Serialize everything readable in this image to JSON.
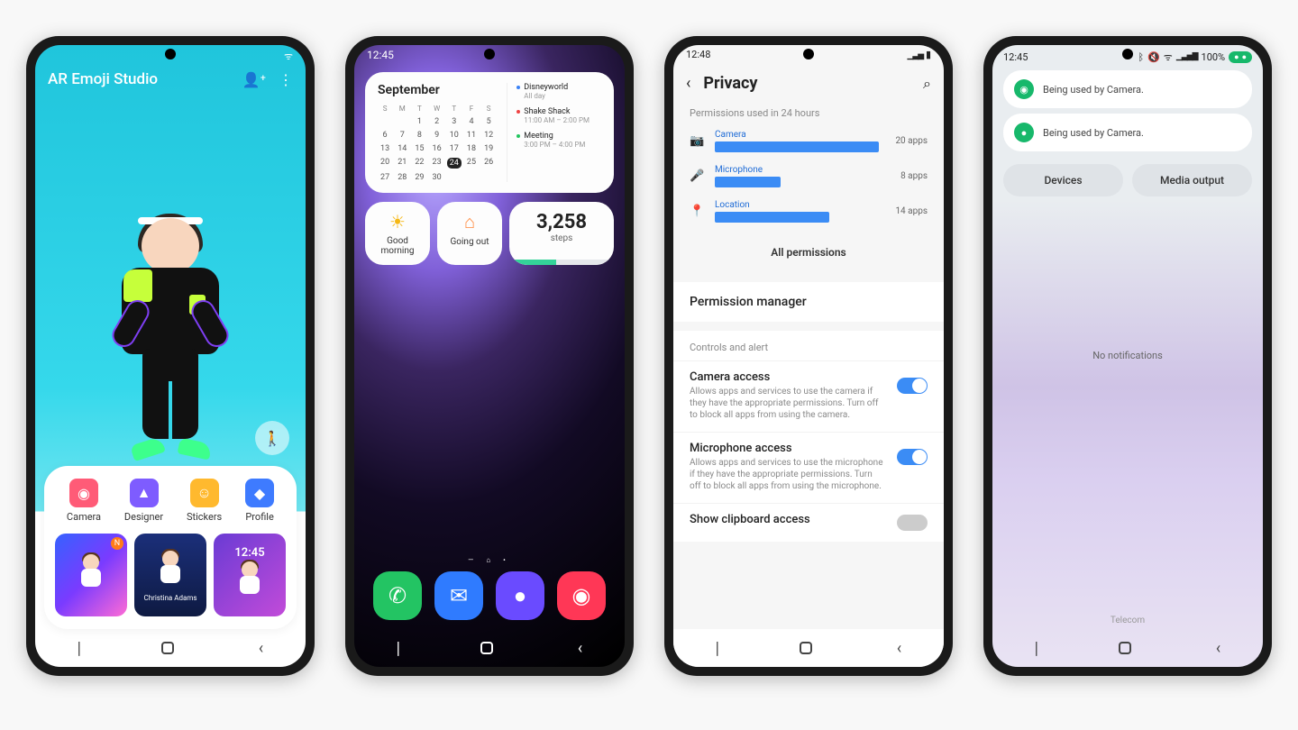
{
  "phone1": {
    "title": "AR Emoji Studio",
    "tools": [
      {
        "label": "Camera",
        "color": "#ff5b77",
        "glyph": "◉"
      },
      {
        "label": "Designer",
        "color": "#7e5cff",
        "glyph": "▲"
      },
      {
        "label": "Stickers",
        "color": "#ffb92e",
        "glyph": "☺"
      },
      {
        "label": "Profile",
        "color": "#3e7bff",
        "glyph": "◆"
      }
    ],
    "thumbs": {
      "newBadge": "N",
      "name": "Christina Adams",
      "lockTime": "12:45"
    }
  },
  "phone2": {
    "time": "12:45",
    "calendar": {
      "month": "September",
      "dows": [
        "S",
        "M",
        "T",
        "W",
        "T",
        "F",
        "S"
      ],
      "days": [
        "",
        "",
        "1",
        "2",
        "3",
        "4",
        "5",
        "6",
        "7",
        "8",
        "9",
        "10",
        "11",
        "12",
        "13",
        "14",
        "15",
        "16",
        "17",
        "18",
        "19",
        "20",
        "21",
        "22",
        "23",
        "24",
        "25",
        "26",
        "27",
        "28",
        "29",
        "30",
        "",
        ""
      ],
      "today": "24",
      "events": [
        {
          "title": "Disneyworld",
          "sub": "All day",
          "cls": "blue"
        },
        {
          "title": "Shake Shack",
          "sub": "11:00 AM – 2:00 PM",
          "cls": "red"
        },
        {
          "title": "Meeting",
          "sub": "3:00 PM – 4:00 PM",
          "cls": "green"
        }
      ]
    },
    "mini": [
      {
        "icon": "☀",
        "label": "Good morning",
        "color": "#f5b815"
      },
      {
        "icon": "⌂",
        "label": "Going out",
        "color": "#ff8a3d"
      }
    ],
    "steps": {
      "value": "3,258",
      "label": "steps",
      "pct": 45
    },
    "dock": [
      {
        "color": "#23c463",
        "glyph": "✆"
      },
      {
        "color": "#2f7bff",
        "glyph": "✉"
      },
      {
        "color": "#6a4bff",
        "glyph": "●"
      },
      {
        "color": "#ff3756",
        "glyph": "◉"
      }
    ]
  },
  "phone3": {
    "time": "12:48",
    "title": "Privacy",
    "usedLabel": "Permissions used in 24 hours",
    "perms": [
      {
        "name": "Camera",
        "count": "20 apps",
        "pct": 100,
        "icon": "📷"
      },
      {
        "name": "Microphone",
        "count": "8 apps",
        "pct": 40,
        "icon": "🎤"
      },
      {
        "name": "Location",
        "count": "14 apps",
        "pct": 70,
        "icon": "📍"
      }
    ],
    "allPermissions": "All permissions",
    "permissionManager": "Permission manager",
    "controlsLabel": "Controls and alert",
    "controls": [
      {
        "title": "Camera access",
        "desc": "Allows apps and services to use the camera if they have the appropriate permissions. Turn off to block all apps from using the camera."
      },
      {
        "title": "Microphone access",
        "desc": "Allows apps and services to use the microphone if they have the appropriate permissions. Turn off to block all apps from using the microphone."
      }
    ],
    "clipboard": "Show clipboard access"
  },
  "phone4": {
    "time": "12:45",
    "battery": "100%",
    "notifs": [
      {
        "color": "#17b86b",
        "glyph": "◉",
        "text": "Being used by Camera."
      },
      {
        "color": "#17b86b",
        "glyph": "●",
        "text": "Being used by Camera."
      }
    ],
    "chips": [
      "Devices",
      "Media output"
    ],
    "noNotif": "No notifications",
    "provider": "Telecom"
  }
}
